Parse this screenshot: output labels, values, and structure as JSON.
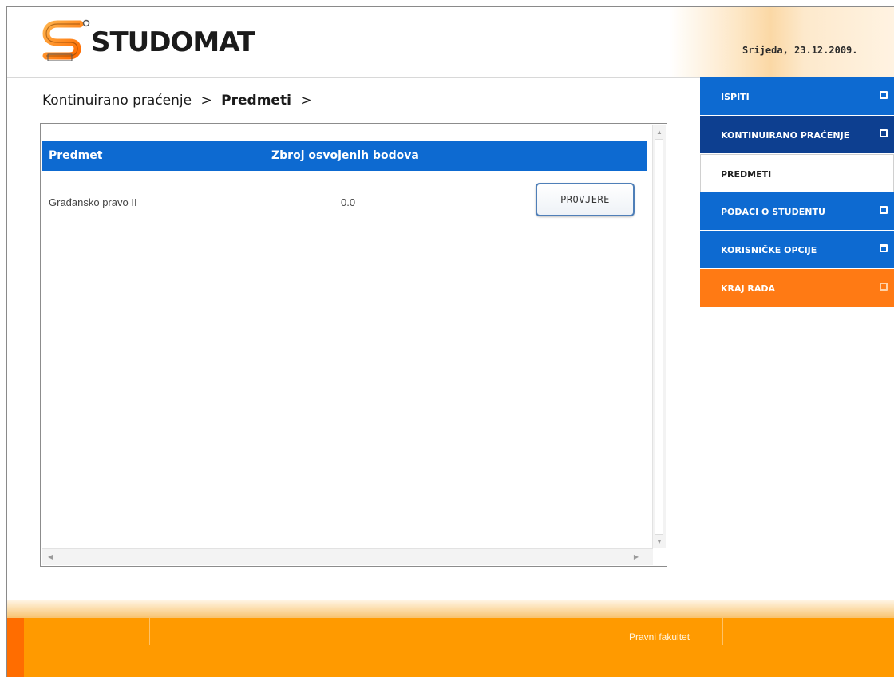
{
  "header": {
    "logo_text": "STUDOMAT",
    "date": "Srijeda, 23.12.2009."
  },
  "breadcrumb": {
    "items": [
      "Kontinuirano praćenje",
      ">",
      "Predmeti",
      ">"
    ]
  },
  "table": {
    "columns": [
      "Predmet",
      "Zbroj osvojenih bodova"
    ],
    "rows": [
      {
        "predmet": "Građansko pravo II",
        "bodovi": "0.0",
        "action": "PROVJERE"
      }
    ]
  },
  "nav": {
    "items": [
      {
        "label": "ISPITI",
        "style": "blue"
      },
      {
        "label": "KONTINUIRANO PRAĆENJE",
        "style": "dark"
      },
      {
        "label": "PREDMETI",
        "style": "white"
      },
      {
        "label": "PODACI O STUDENTU",
        "style": "blue"
      },
      {
        "label": "KORISNIČKE OPCIJE",
        "style": "blue"
      },
      {
        "label": "KRAJ RADA",
        "style": "orange"
      }
    ]
  },
  "footer": {
    "right_link": "Pravni fakultet"
  },
  "colors": {
    "nav_blue": "#0d6ad1",
    "nav_dark": "#0d3f90",
    "nav_orange": "#ff7a14",
    "footer_orange": "#ff9a00",
    "table_header": "#0d6ad1"
  }
}
